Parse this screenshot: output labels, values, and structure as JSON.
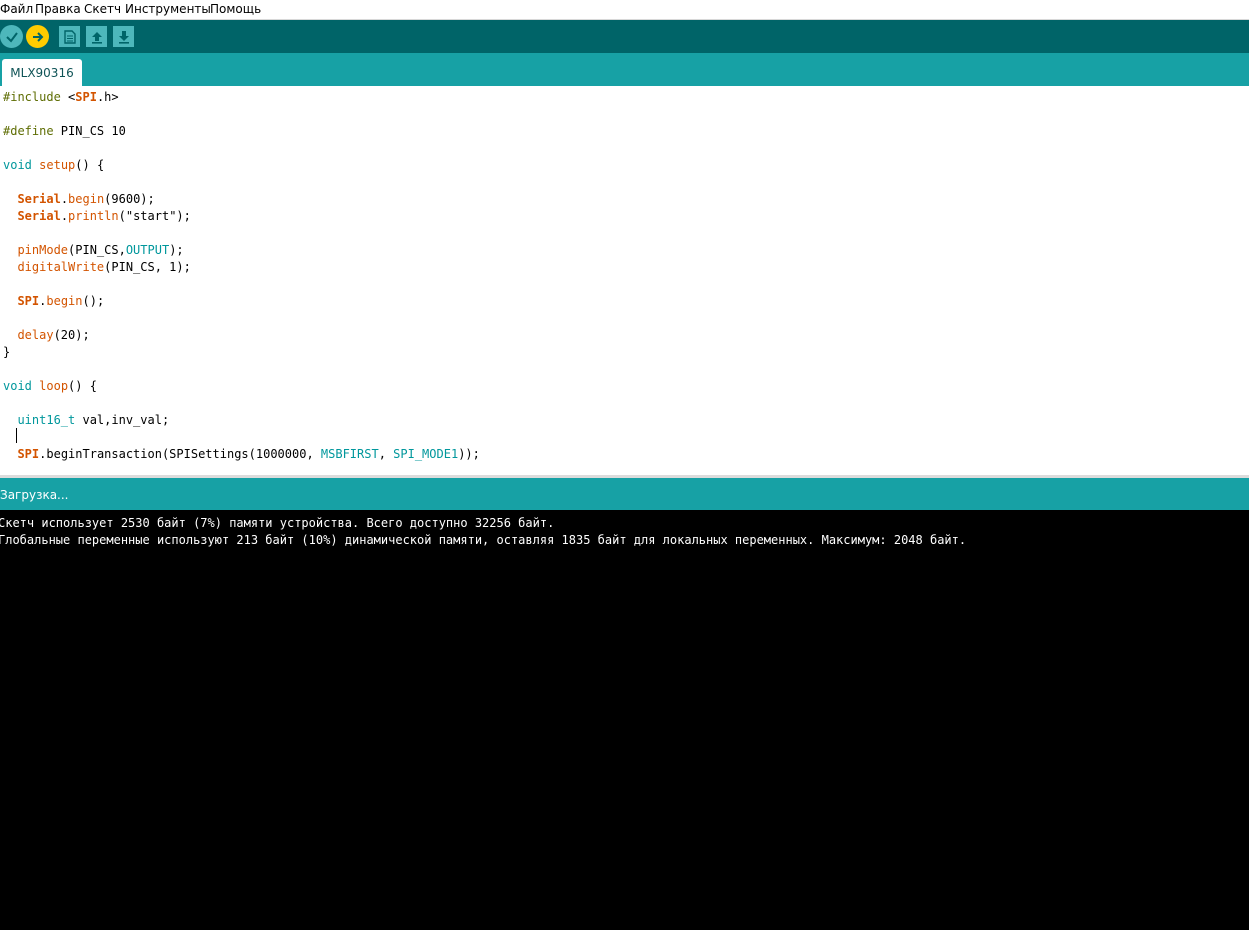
{
  "menu": [
    "Файл",
    "Правка",
    "Скетч",
    "Инструменты",
    "Помощь"
  ],
  "toolbar": {
    "buttons": [
      {
        "name": "verify",
        "icon": "checkmark-icon"
      },
      {
        "name": "upload",
        "icon": "arrow-right-icon"
      },
      {
        "name": "new",
        "icon": "new-file-icon"
      },
      {
        "name": "open",
        "icon": "open-arrow-up-icon"
      },
      {
        "name": "save",
        "icon": "save-arrow-down-icon"
      }
    ]
  },
  "tabs": [
    {
      "label": "MLX90316"
    }
  ],
  "editor": {
    "lines": [
      "#include <SPI.h>",
      "",
      "#define PIN_CS 10",
      "",
      "void setup() {",
      "",
      "  Serial.begin(9600);",
      "  Serial.println(\"start\");",
      "",
      "  pinMode(PIN_CS,OUTPUT);",
      "  digitalWrite(PIN_CS, 1);",
      "",
      "  SPI.begin();",
      "",
      "  delay(20);",
      "}",
      "",
      "void loop() {",
      "",
      "  uint16_t val,inv_val;",
      "",
      "  SPI.beginTransaction(SPISettings(1000000, MSBFIRST, SPI_MODE1));"
    ]
  },
  "status": {
    "text": "Загрузка..."
  },
  "console": {
    "lines": [
      "Скетч использует 2530 байт (7%) памяти устройства. Всего доступно 32256 байт.",
      "Глобальные переменные используют 213 байт (10%) динамической памяти, оставляя 1835 байт для локальных переменных. Максимум: 2048 байт."
    ]
  },
  "colors": {
    "toolbar_bg": "#006468",
    "tab_bar_bg": "#17a1a5",
    "verify_button": "#4db7bb",
    "upload_button": "#ffcc00",
    "keyword": "#00979c",
    "function": "#d35400",
    "preprocessor": "#5e6d03",
    "console_bg": "#000000"
  }
}
